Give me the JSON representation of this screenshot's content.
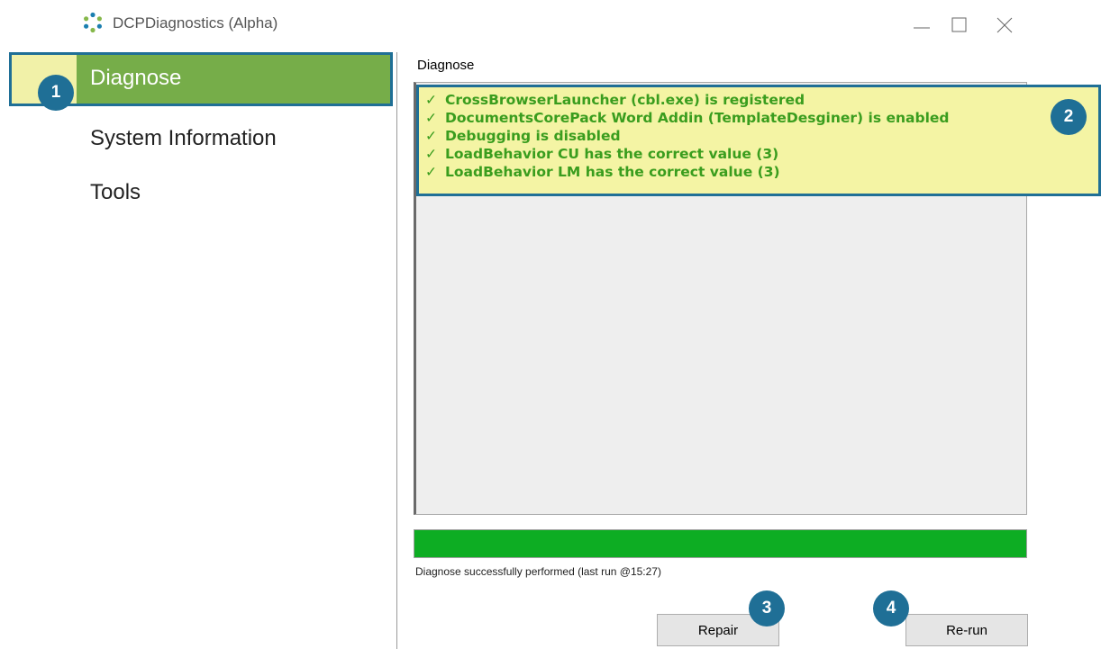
{
  "window": {
    "title": "DCPDiagnostics (Alpha)",
    "app_icon": "circular-dots-logo-icon",
    "controls": [
      "minimize-icon",
      "maximize-icon",
      "close-icon"
    ]
  },
  "sidebar": {
    "items": [
      {
        "label": "Diagnose",
        "selected": true
      },
      {
        "label": "System Information",
        "selected": false
      },
      {
        "label": "Tools",
        "selected": false
      }
    ]
  },
  "main": {
    "title": "Diagnose",
    "results": [
      {
        "check": "✓",
        "text": "CrossBrowserLauncher (cbl.exe) is registered"
      },
      {
        "check": "✓",
        "text": "DocumentsCorePack Word Addin (TemplateDesginer) is enabled"
      },
      {
        "check": "✓",
        "text": "Debugging is disabled"
      },
      {
        "check": "✓",
        "text": "LoadBehavior CU has the correct value (3)"
      },
      {
        "check": "✓",
        "text": "LoadBehavior LM has the correct value (3)"
      }
    ],
    "progress_percent": 100,
    "status": "Diagnose successfully performed (last run @15:27)",
    "buttons": {
      "repair": "Repair",
      "rerun": "Re-run"
    }
  },
  "annotations": {
    "badge_1": "1",
    "badge_2": "2",
    "badge_3": "3",
    "badge_4": "4"
  },
  "colors": {
    "selected_nav": "#76ad49",
    "highlight_fill": "#f4f4a4",
    "annotation_blue": "#1f6f96",
    "result_text": "#3a9d1e",
    "progress_fill": "#0dad23"
  }
}
